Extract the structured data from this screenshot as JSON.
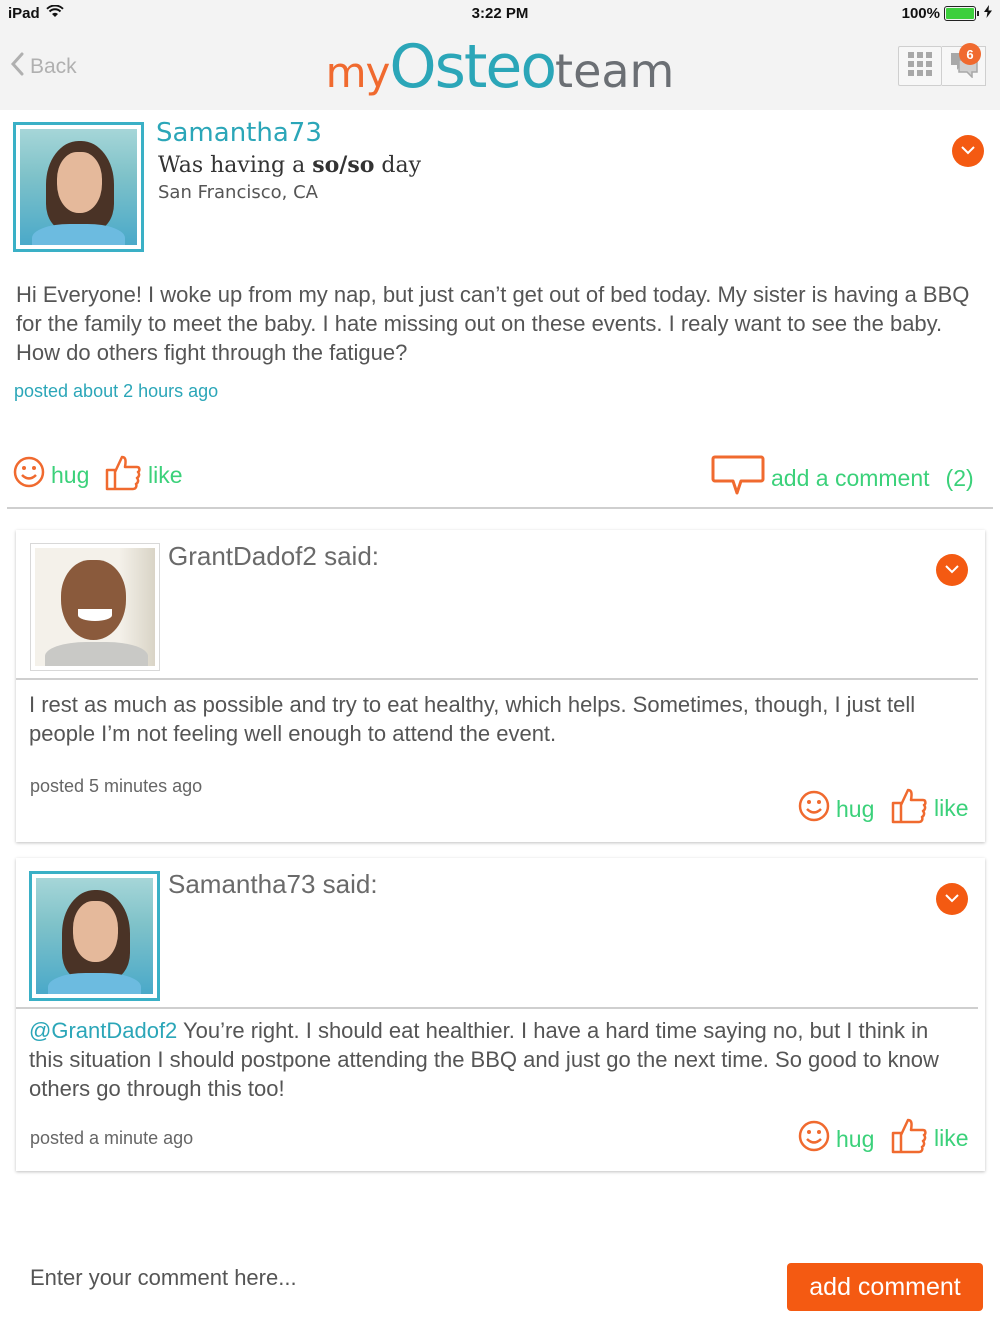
{
  "status_bar": {
    "device": "iPad",
    "time": "3:22 PM",
    "battery": "100%"
  },
  "nav": {
    "back_label": "Back",
    "logo": {
      "my": "my",
      "osteo": "Osteo",
      "team": "team"
    },
    "messages_badge": "6"
  },
  "post": {
    "username": "Samantha73",
    "mood_prefix": "Was having a ",
    "mood_value": "so/so",
    "mood_suffix": " day",
    "location": "San Francisco, CA",
    "body": "Hi Everyone! I woke up from my nap, but just can’t get out of bed today. My sister is having a BBQ for the family to meet the baby. I hate missing out on these events. I realy want to see the baby. How do others fight through the fatigue?",
    "time": "posted about 2 hours ago",
    "hug_label": "hug",
    "like_label": "like",
    "add_comment_label": "add a comment",
    "comment_count": "(2)"
  },
  "comments": [
    {
      "author_line": "GrantDadof2 said:",
      "mention": "",
      "body": "I rest as much as possible and try to eat healthy, which helps. Sometimes, though, I just tell people I’m not feeling well enough to attend the event.",
      "time": "posted 5 minutes ago",
      "hug_label": "hug",
      "like_label": "like"
    },
    {
      "author_line": "Samantha73 said:",
      "mention": "@GrantDadof2",
      "body": " You’re right. I should eat healthier. I have a hard time saying no, but I think in this situation I should postpone attending the BBQ and just go the next time. So good to know others go through this too!",
      "time": "posted a  minute ago",
      "hug_label": "hug",
      "like_label": "like"
    }
  ],
  "composer": {
    "placeholder": "Enter your comment here...",
    "submit_label": "add comment"
  },
  "colors": {
    "orange": "#f45a12",
    "teal": "#2ba6b8",
    "green": "#3bd17a"
  },
  "icons": [
    "wifi-icon",
    "battery-icon",
    "charging-icon",
    "back-chevron-icon",
    "grid-icon",
    "messages-icon",
    "chevron-down-icon",
    "smiley-icon",
    "thumbs-up-icon",
    "speech-bubble-icon"
  ]
}
